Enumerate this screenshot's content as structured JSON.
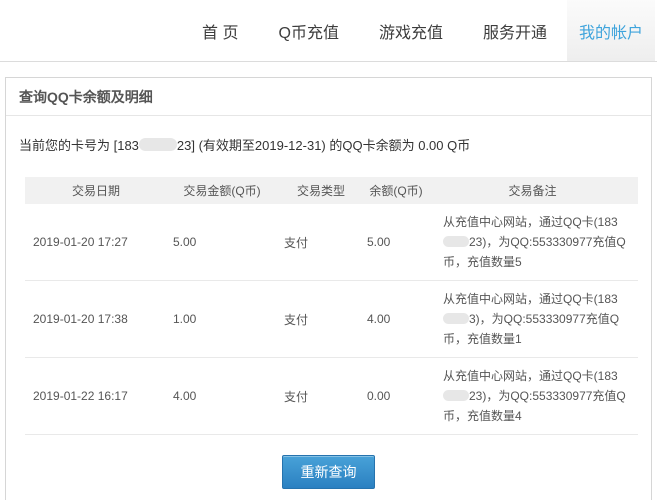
{
  "nav": {
    "items": [
      {
        "label": "首 页",
        "active": false
      },
      {
        "label": "Q币充值",
        "active": false
      },
      {
        "label": "游戏充值",
        "active": false
      },
      {
        "label": "服务开通",
        "active": false
      },
      {
        "label": "我的帐户",
        "active": true
      }
    ],
    "active_color": "#3fa4dc"
  },
  "panel": {
    "title": "查询QQ卡余额及明细",
    "info": {
      "prefix": "当前您的卡号为 [183",
      "masked_digits": "hidden",
      "suffix": "23] (有效期至2019-12-31) 的QQ卡余额为 0.00 Q币"
    },
    "table": {
      "headers": {
        "date": "交易日期",
        "amount": "交易金额(Q币)",
        "type": "交易类型",
        "balance": "余额(Q币)",
        "remark": "交易备注"
      },
      "rows": [
        {
          "date": "2019-01-20 17:27",
          "amount": "5.00",
          "type": "支付",
          "balance": "5.00",
          "remark_pre": "从充值中心网站，通过QQ卡(183",
          "remark_post": "23)，为QQ:553330977充值Q币，充值数量5"
        },
        {
          "date": "2019-01-20 17:38",
          "amount": "1.00",
          "type": "支付",
          "balance": "4.00",
          "remark_pre": "从充值中心网站，通过QQ卡(183",
          "remark_post": "3)，为QQ:553330977充值Q币，充值数量1"
        },
        {
          "date": "2019-01-22 16:17",
          "amount": "4.00",
          "type": "支付",
          "balance": "0.00",
          "remark_pre": "从充值中心网站，通过QQ卡(183",
          "remark_post": "23)，为QQ:553330977充值Q币，充值数量4"
        }
      ]
    },
    "requery_button_label": "重新查询",
    "button_color": "#2b80c1"
  }
}
